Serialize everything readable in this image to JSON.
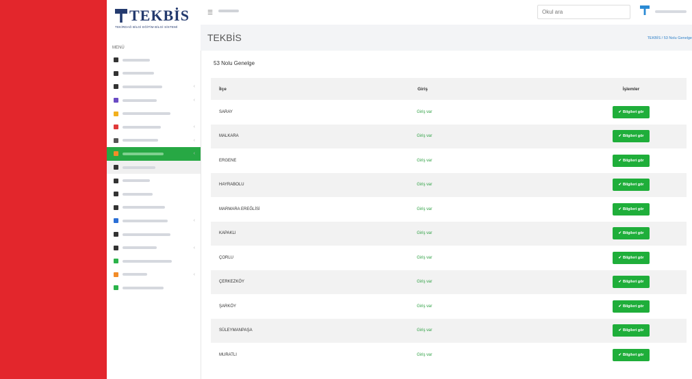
{
  "app": {
    "logo_text": "TEKBİS",
    "logo_subtitle": "TEKİRDAĞ BİLGİ EĞİTİM BİLGİ SİSTEMİ",
    "menu_label": "MENÜ"
  },
  "sidebar": {
    "items": [
      {
        "icon": "home-icon",
        "color": "#333333",
        "w": 40
      },
      {
        "icon": "user-icon",
        "color": "#333333",
        "w": 46
      },
      {
        "icon": "chat-icon",
        "color": "#333333",
        "w": 58,
        "chev": true
      },
      {
        "icon": "calendar-icon",
        "color": "#6a4bc4",
        "w": 50,
        "chev": true
      },
      {
        "icon": "bell-icon",
        "color": "#f2b01e",
        "w": 70
      },
      {
        "icon": "user-red-icon",
        "color": "#e03a3a",
        "w": 56,
        "chev": true
      },
      {
        "icon": "clock-icon",
        "color": "#555555",
        "w": 52,
        "chev": true
      },
      {
        "icon": "folder-icon",
        "color": "#f28c28",
        "w": 60,
        "active": true,
        "chev": true
      },
      {
        "icon": "copy-icon",
        "color": "#333333",
        "w": 48,
        "hover": true
      },
      {
        "icon": "copy-icon",
        "color": "#333333",
        "w": 40
      },
      {
        "icon": "copy-icon",
        "color": "#333333",
        "w": 44
      },
      {
        "icon": "copy-icon",
        "color": "#333333",
        "w": 62
      },
      {
        "icon": "layers-icon",
        "color": "#2a6fd6",
        "w": 66,
        "chev": true
      },
      {
        "icon": "chart-icon",
        "color": "#333333",
        "w": 70
      },
      {
        "icon": "share-icon",
        "color": "#333333",
        "w": 50,
        "chev": true
      },
      {
        "icon": "leaf-icon",
        "color": "#2bb34a",
        "w": 72
      },
      {
        "icon": "pin-icon",
        "color": "#f28c28",
        "w": 36,
        "chev": true
      },
      {
        "icon": "grid-icon",
        "color": "#2bb34a",
        "w": 60
      }
    ]
  },
  "topbar": {
    "search_value": "Okul ara"
  },
  "page": {
    "title": "TEKBİS",
    "breadcrumb": "TEKBİS / 53 Nolu Genelge"
  },
  "card": {
    "title": "53 Nolu Genelge",
    "columns": [
      "İlçe",
      "Giriş",
      "İşlemler"
    ],
    "button_label": "Bilgileri gör",
    "rows": [
      {
        "ilce": "SARAY",
        "giris": "Giriş var"
      },
      {
        "ilce": "MALKARA",
        "giris": "Giriş var"
      },
      {
        "ilce": "ERGENE",
        "giris": "Giriş var"
      },
      {
        "ilce": "HAYRABOLU",
        "giris": "Giriş var"
      },
      {
        "ilce": "MARMARA EREĞLİSİ",
        "giris": "Giriş var"
      },
      {
        "ilce": "KAPAKLI",
        "giris": "Giriş var"
      },
      {
        "ilce": "ÇORLU",
        "giris": "Giriş var"
      },
      {
        "ilce": "ÇERKEZKÖY",
        "giris": "Giriş var"
      },
      {
        "ilce": "ŞARKÖY",
        "giris": "Giriş var"
      },
      {
        "ilce": "SÜLEYMANPAŞA",
        "giris": "Giriş var"
      },
      {
        "ilce": "MURATLI",
        "giris": "Giriş var"
      }
    ]
  }
}
